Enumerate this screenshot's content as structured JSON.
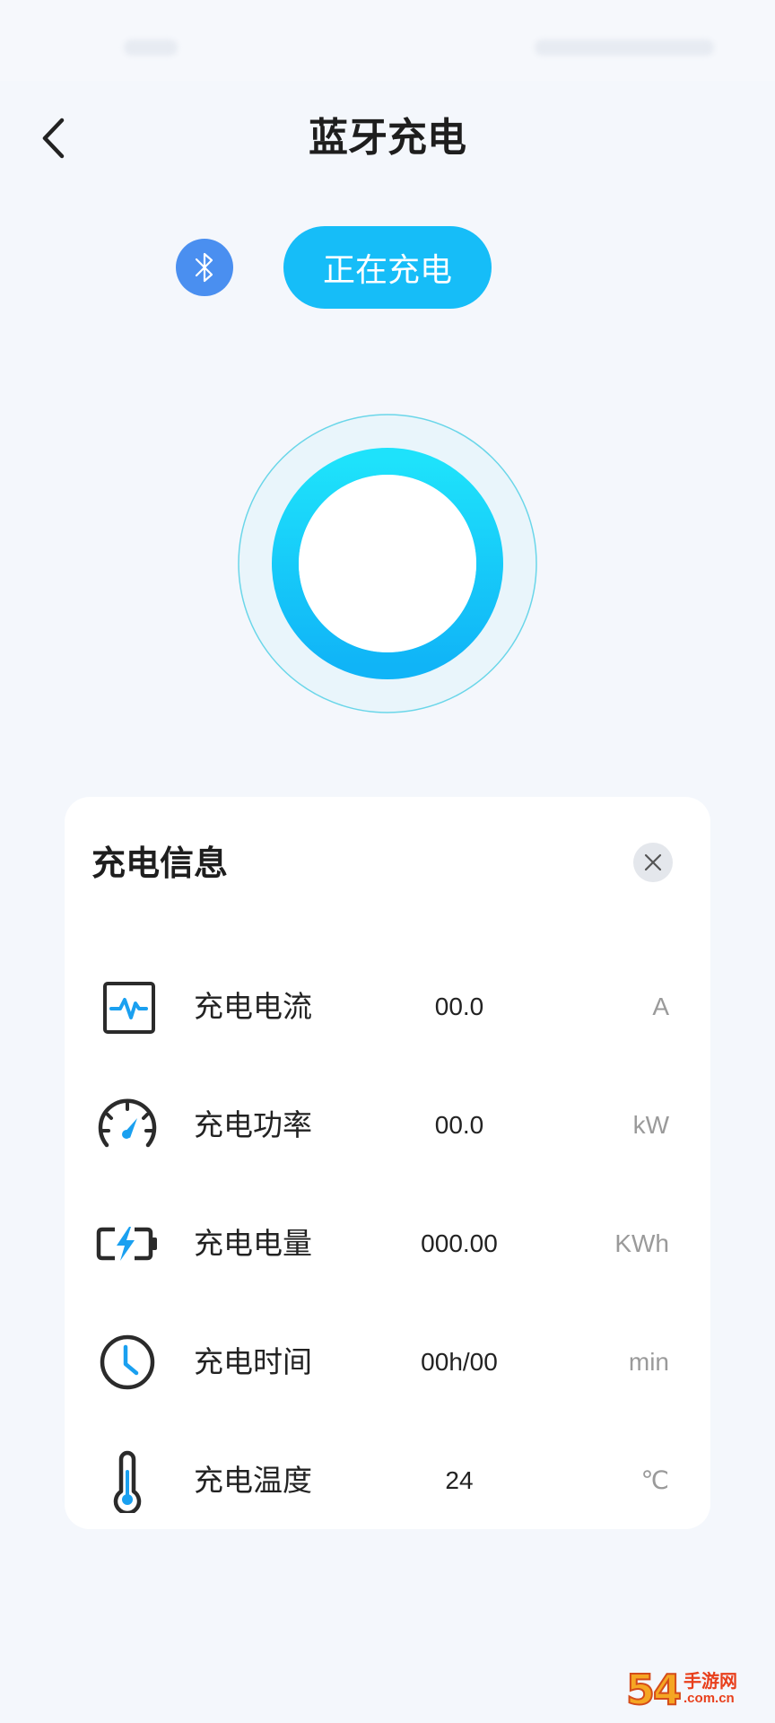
{
  "header": {
    "title": "蓝牙充电",
    "back_icon": "chevron-left-icon"
  },
  "connection": {
    "bt_icon": "bluetooth-icon",
    "status_label": "正在充电",
    "status_color": "#16bdf8"
  },
  "info_card": {
    "title": "充电信息",
    "close_icon": "close-icon",
    "rows": [
      {
        "label": "充电电流",
        "value": "00.0",
        "unit": "A",
        "icon": "pulse-monitor-icon"
      },
      {
        "label": "充电功率",
        "value": "00.0",
        "unit": "kW",
        "icon": "speedometer-icon"
      },
      {
        "label": "充电电量",
        "value": "000.00",
        "unit": "KWh",
        "icon": "battery-charging-icon"
      },
      {
        "label": "充电时间",
        "value": "00h/00",
        "unit": "min",
        "icon": "clock-icon"
      },
      {
        "label": "充电温度",
        "value": "24",
        "unit": "℃",
        "icon": "thermometer-icon"
      }
    ]
  },
  "watermark": {
    "number": "54",
    "site_name": "手游网",
    "domain": ".com.cn"
  },
  "colors": {
    "accent": "#16bdf8",
    "icon_accent": "#1aa0f0",
    "background": "#f4f7fc"
  }
}
